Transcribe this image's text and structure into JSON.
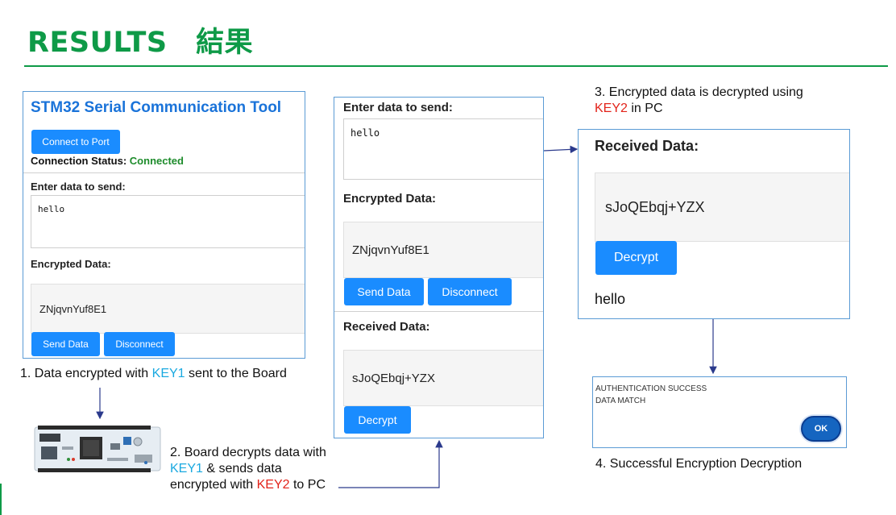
{
  "slide": {
    "title": "RESULTS　結果"
  },
  "panel1": {
    "app_title": "STM32 Serial Communication Tool",
    "connect_button": "Connect to Port",
    "status_label": "Connection Status:",
    "status_value": "Connected",
    "enter_label": "Enter data to send:",
    "input_value": "hello",
    "encrypted_label": "Encrypted Data:",
    "encrypted_value": "ZNjqvnYuf8E1",
    "send_button": "Send Data",
    "disconnect_button": "Disconnect"
  },
  "panel2": {
    "enter_label": "Enter data to send:",
    "input_value": "hello",
    "encrypted_label": "Encrypted Data:",
    "encrypted_value": "ZNjqvnYuf8E1",
    "send_button": "Send Data",
    "disconnect_button": "Disconnect",
    "received_label": "Received Data:",
    "received_value": "sJoQEbqj+YZX",
    "decrypt_button": "Decrypt"
  },
  "panel3": {
    "received_label": "Received Data:",
    "received_value": "sJoQEbqj+YZX",
    "decrypt_button": "Decrypt",
    "decrypted_value": "hello"
  },
  "dialog": {
    "line1": "AUTHENTICATION SUCCESS",
    "line2": "DATA MATCH",
    "ok_button": "OK"
  },
  "captions": {
    "step1_prefix": "1. Data encrypted with ",
    "step1_key": "KEY1",
    "step1_suffix": " sent to the Board",
    "step2_line1": "2. Board decrypts data with",
    "step2_key1": "KEY1",
    "step2_line2_suffix": " & sends data",
    "step2_line3_prefix": "encrypted with ",
    "step2_key2": "KEY2",
    "step2_line3_suffix": " to PC",
    "step3_line1": "3. Encrypted data is decrypted using",
    "step3_key": "KEY2",
    "step3_line2_suffix": " in PC",
    "step4": "4. Successful Encryption Decryption"
  },
  "colors": {
    "title_green": "#0e9a47",
    "button_blue": "#1a8cff",
    "panel_border": "#5b9bd5",
    "key1_blue": "#1aa9e0",
    "key2_red": "#e2231a",
    "connected_green": "#1e8c2c"
  },
  "icons": {
    "board": "stm32-nucleo-board-image"
  }
}
